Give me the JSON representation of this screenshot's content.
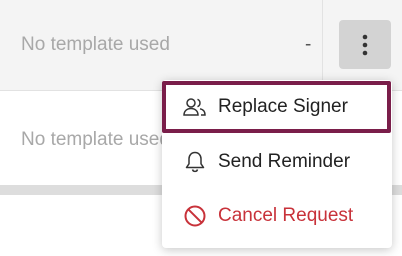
{
  "table": {
    "rows": [
      {
        "template": "No template used",
        "signer": "-"
      },
      {
        "template": "No template used"
      }
    ]
  },
  "actions_menu": {
    "items": [
      {
        "label": "Replace Signer",
        "icon": "users-icon"
      },
      {
        "label": "Send Reminder",
        "icon": "bell-icon"
      },
      {
        "label": "Cancel Request",
        "icon": "ban-icon"
      }
    ]
  },
  "colors": {
    "focus_ring": "#7a1e4a",
    "danger": "#c8323a",
    "kebab_bg": "#d3d3d3"
  }
}
